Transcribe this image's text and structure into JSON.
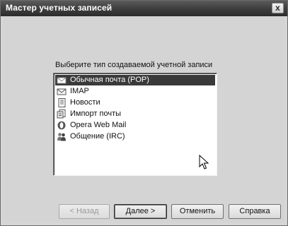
{
  "window": {
    "title": "Мастер учетных записей",
    "close_label": "x"
  },
  "prompt": "Выберите тип создаваемой учетной записи",
  "account_types": [
    {
      "label": "Обычная почта (POP)",
      "icon": "mail-envelope-icon",
      "selected": true
    },
    {
      "label": "IMAP",
      "icon": "imap-envelope-icon",
      "selected": false
    },
    {
      "label": "Новости",
      "icon": "news-document-icon",
      "selected": false
    },
    {
      "label": "Импорт почты",
      "icon": "import-mail-icon",
      "selected": false
    },
    {
      "label": "Opera Web Mail",
      "icon": "opera-logo-icon",
      "selected": false
    },
    {
      "label": "Общение (IRC)",
      "icon": "chat-people-icon",
      "selected": false
    }
  ],
  "buttons": {
    "back": "< Назад",
    "next": "Далее >",
    "cancel": "Отменить",
    "help": "Справка"
  }
}
